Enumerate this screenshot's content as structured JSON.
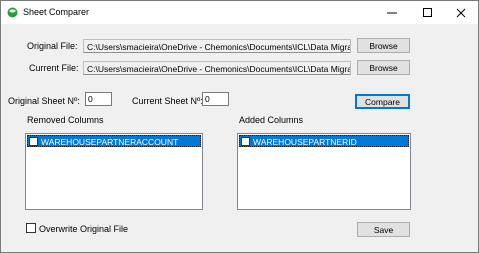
{
  "window": {
    "title": "Sheet Comparer",
    "controls": {
      "minimize": "—",
      "maximize": "☐",
      "close": "✕"
    }
  },
  "form": {
    "original_file_label": "Original File:",
    "original_file_value": "C:\\Users\\smacieira\\OneDrive - Chemonics\\Documents\\ICL\\Data Migratio",
    "current_file_label": "Current File:",
    "current_file_value": "C:\\Users\\smacieira\\OneDrive - Chemonics\\Documents\\ICL\\Data Migratio",
    "browse_label": "Browse",
    "original_sheet_label": "Original Sheet Nº:",
    "original_sheet_value": "0",
    "current_sheet_label": "Current Sheet Nº:",
    "current_sheet_value": "0",
    "compare_label": "Compare",
    "removed_columns_label": "Removed Columns",
    "removed_columns": [
      "WAREHOUSEPARTNERACCOUNT"
    ],
    "added_columns_label": "Added Columns",
    "added_columns": [
      "WAREHOUSEPARTNERID"
    ],
    "overwrite_label": "Overwrite Original File",
    "save_label": "Save"
  },
  "colors": {
    "accent": "#0078d7",
    "window_bg": "#f0f0f0",
    "selection": "#0078d7"
  }
}
